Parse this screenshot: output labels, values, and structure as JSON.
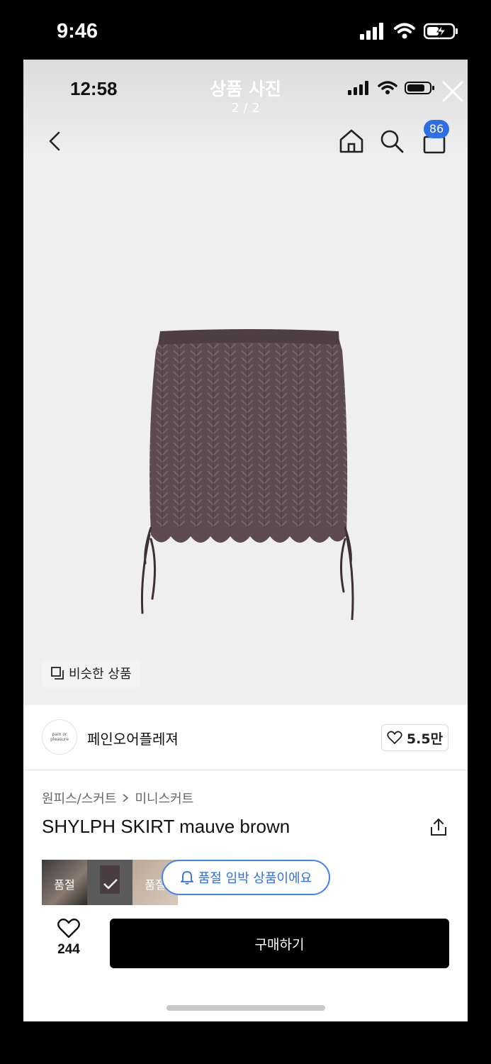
{
  "outer_status": {
    "time": "9:46"
  },
  "inner_status": {
    "time": "12:58"
  },
  "photo_header": {
    "title": "상품 사진",
    "counter": "2 / 2"
  },
  "nav": {
    "cart_count": "86"
  },
  "similar": {
    "label": "비슷한 상품"
  },
  "brand": {
    "logo_text": "pain or pleasure",
    "name": "페인오어플레져",
    "likes": "5.5만"
  },
  "breadcrumb": {
    "level1": "원피스/스커트",
    "level2": "미니스커트"
  },
  "product": {
    "name": "SHYLPH SKIRT mauve brown"
  },
  "thumbs": [
    {
      "label": "품절"
    },
    {
      "label": ""
    },
    {
      "label": "품절"
    }
  ],
  "toast": {
    "text": "품절 임박 상품이에요"
  },
  "bottom": {
    "wish_count": "244",
    "buy_label": "구매하기"
  },
  "colors": {
    "accent_blue": "#2f6fe6",
    "skirt": "#5e4b51",
    "buy_button": "#000000"
  },
  "icons": [
    "signal-icon",
    "wifi-icon",
    "battery-icon",
    "close-icon",
    "back-icon",
    "home-icon",
    "search-icon",
    "cart-icon",
    "copy-icon",
    "heart-icon",
    "chevron-right-icon",
    "share-icon",
    "bell-icon",
    "check-icon"
  ]
}
